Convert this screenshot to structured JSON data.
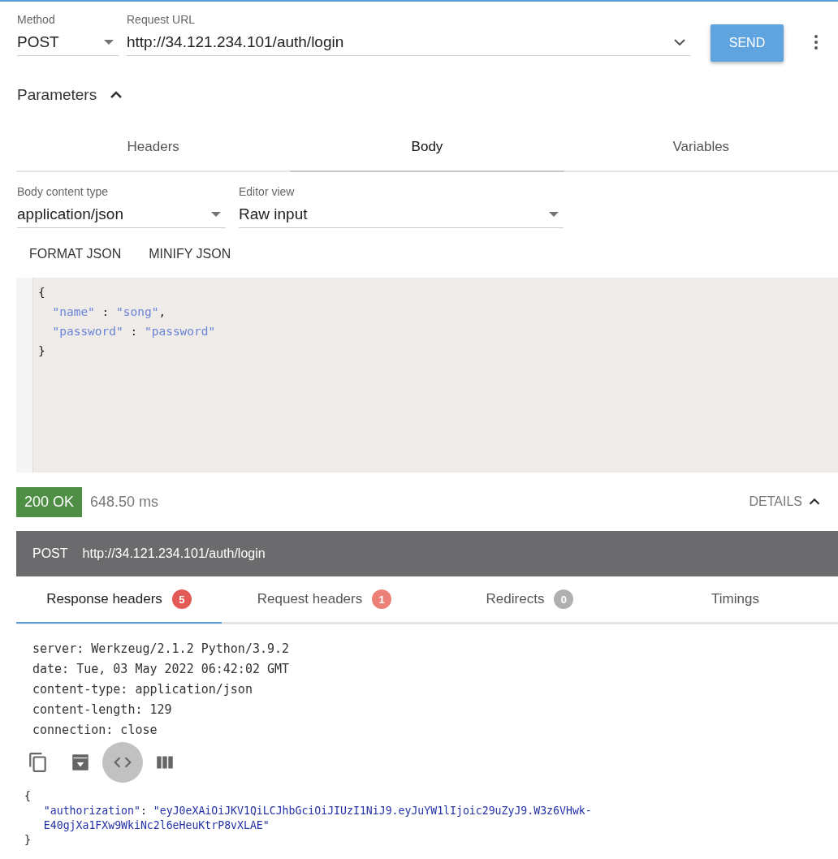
{
  "request": {
    "method": {
      "label": "Method",
      "value": "POST"
    },
    "url": {
      "label": "Request URL",
      "value": "http://34.121.234.101/auth/login"
    },
    "send": "SEND"
  },
  "parameters": {
    "title": "Parameters",
    "expanded": true
  },
  "tabs": [
    {
      "label": "Headers",
      "selected": false
    },
    {
      "label": "Body",
      "selected": true
    },
    {
      "label": "Variables",
      "selected": false
    }
  ],
  "body": {
    "content_type": {
      "label": "Body content type",
      "value": "application/json"
    },
    "editor_view": {
      "label": "Editor view",
      "value": "Raw input"
    },
    "actions": [
      "FORMAT JSON",
      "MINIFY JSON"
    ],
    "editor_lines": [
      [
        {
          "text": "{",
          "kind": "punct"
        }
      ],
      [
        {
          "text": "  \"name\"",
          "kind": "string"
        },
        {
          "text": " : ",
          "kind": "punct"
        },
        {
          "text": "\"song\"",
          "kind": "string"
        },
        {
          "text": ",",
          "kind": "punct"
        }
      ],
      [
        {
          "text": "  \"password\"",
          "kind": "string"
        },
        {
          "text": " : ",
          "kind": "punct"
        },
        {
          "text": "\"password\"",
          "kind": "string"
        }
      ],
      [
        {
          "text": "}",
          "kind": "punct"
        }
      ]
    ]
  },
  "response": {
    "status": {
      "text": "200 OK",
      "color": "#4f8f45"
    },
    "time": "648.50 ms",
    "details": "DETAILS",
    "details_expanded": true,
    "summary": {
      "method": "POST",
      "url": "http://34.121.234.101/auth/login"
    },
    "tabs": [
      {
        "label": "Response headers",
        "count": "5",
        "color": "#e35a56",
        "selected": true
      },
      {
        "label": "Request headers",
        "count": "1",
        "color": "#ec8078",
        "selected": false
      },
      {
        "label": "Redirects",
        "count": "0",
        "color": "#b0b0b0",
        "selected": false
      },
      {
        "label": "Timings",
        "selected": false
      }
    ],
    "headers": [
      "server: Werkzeug/2.1.2 Python/3.9.2",
      "date: Tue, 03 May 2022 06:42:02 GMT",
      "content-type: application/json",
      "content-length: 129",
      "connection: close"
    ],
    "toolbar": [
      {
        "kind": "copy",
        "selected": false
      },
      {
        "kind": "save",
        "selected": false
      },
      {
        "kind": "code",
        "selected": true
      },
      {
        "kind": "columns",
        "selected": false
      }
    ],
    "body_lines": [
      [
        {
          "text": "{",
          "kind": "punct"
        }
      ],
      [
        {
          "text": "   \"authorization\"",
          "kind": "string"
        },
        {
          "text": ": ",
          "kind": "punct"
        },
        {
          "text": "\"eyJ0eXAiOiJKV1QiLCJhbGciOiJIUzI1NiJ9.eyJuYW1lIjoic29uZyJ9.W3z6VHwk-",
          "kind": "string"
        }
      ],
      [
        {
          "text": "   E40gjXa1FXw9WkiNc2l6eHeuKtrP8vXLAE\"",
          "kind": "string"
        }
      ],
      [
        {
          "text": "}",
          "kind": "punct"
        }
      ]
    ]
  }
}
